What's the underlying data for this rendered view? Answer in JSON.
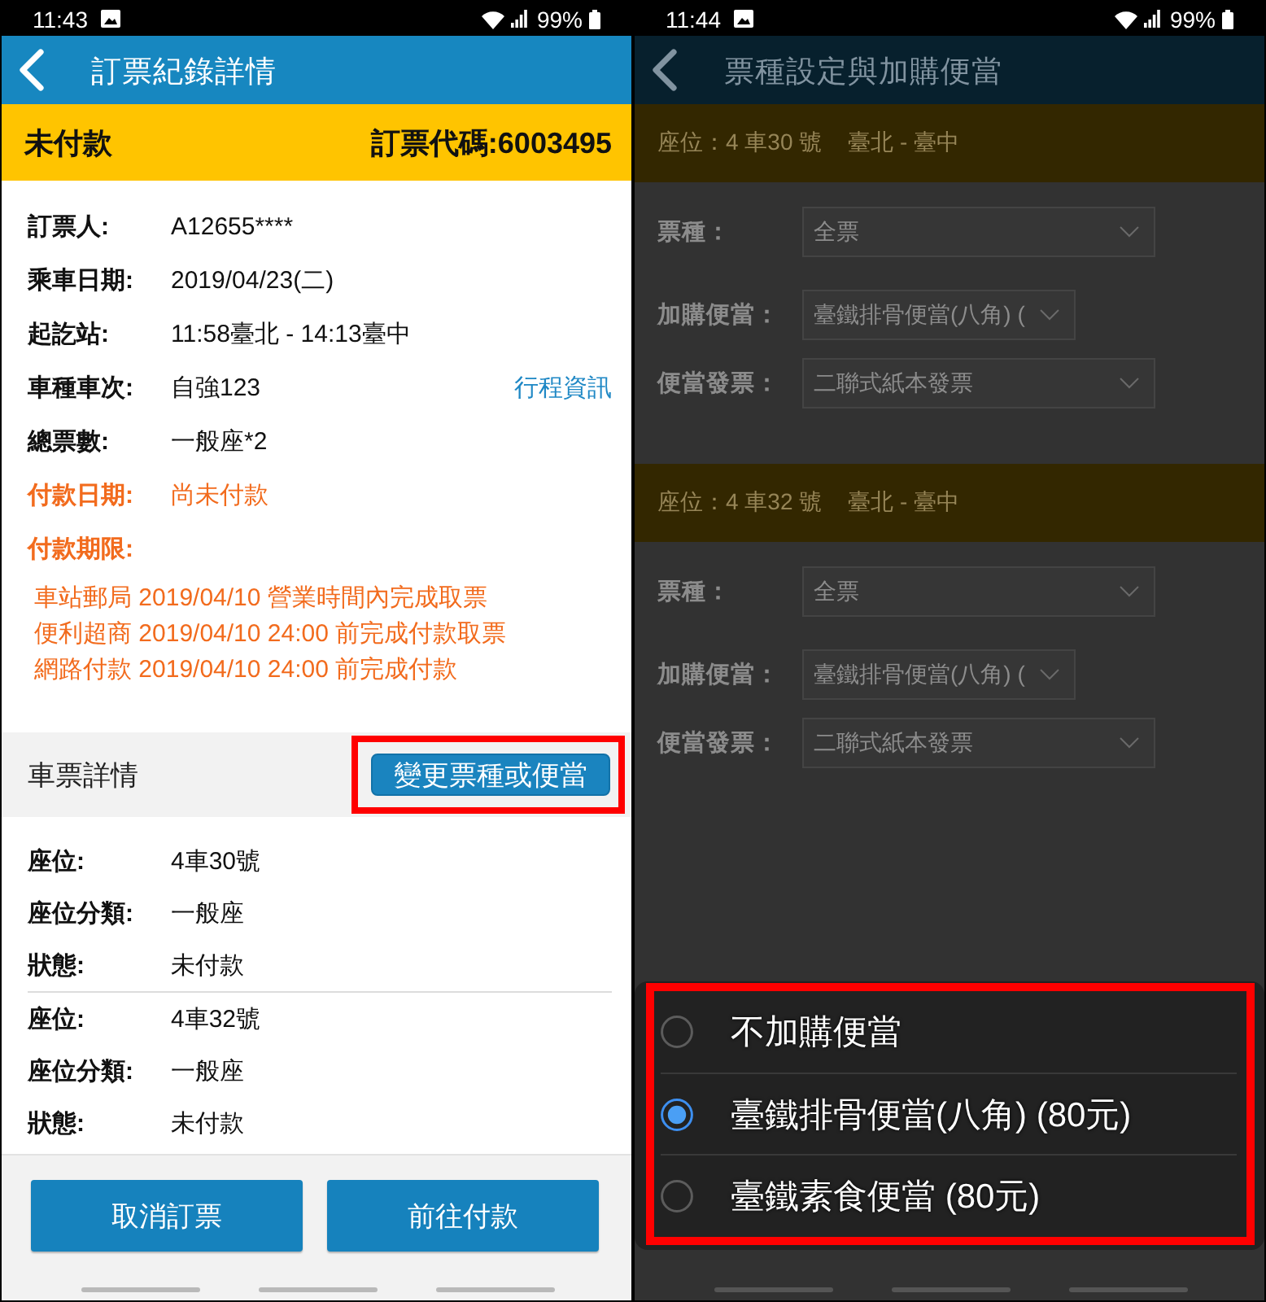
{
  "booking_detail_screen": {
    "status_bar": {
      "time": "11:43",
      "battery": "99%"
    },
    "app_bar": {
      "title": "訂票紀錄詳情"
    },
    "status_banner": {
      "status": "未付款",
      "booking_code": "訂票代碼:6003495"
    },
    "info_rows": [
      {
        "label": "訂票人:",
        "value": "A12655****",
        "warning": false
      },
      {
        "label": "乘車日期:",
        "value": "2019/04/23(二)",
        "warning": false
      },
      {
        "label": "起訖站:",
        "value": "11:58臺北 - 14:13臺中",
        "warning": false
      },
      {
        "label": "車種車次:",
        "value": "自強123",
        "warning": false,
        "link": "行程資訊"
      },
      {
        "label": "總票數:",
        "value": "一般座*2",
        "warning": false
      },
      {
        "label": "付款日期:",
        "value": "尚未付款",
        "warning": true
      }
    ],
    "payment_deadline": {
      "label": "付款期限:",
      "notes": [
        "車站郵局 2019/04/10 營業時間內完成取票",
        "便利超商 2019/04/10 24:00 前完成付款取票",
        "網路付款 2019/04/10 24:00 前完成付款"
      ]
    },
    "ticket_details": {
      "title": "車票詳情",
      "action": {
        "label": "變更票種或便當",
        "highlighted": true
      },
      "seats": [
        {
          "rows": [
            {
              "label": "座位:",
              "value": "4車30號"
            },
            {
              "label": "座位分類:",
              "value": "一般座"
            },
            {
              "label": "狀態:",
              "value": "未付款"
            }
          ]
        },
        {
          "rows": [
            {
              "label": "座位:",
              "value": "4車32號"
            },
            {
              "label": "座位分類:",
              "value": "一般座"
            },
            {
              "label": "狀態:",
              "value": "未付款"
            }
          ]
        }
      ]
    },
    "buttons": [
      "取消訂票",
      "前往付款"
    ]
  },
  "meal_settings_screen": {
    "status_bar": {
      "time": "11:44",
      "battery": "99%"
    },
    "app_bar": {
      "title": "票種設定與加購便當"
    },
    "dimmed": true,
    "seats": [
      {
        "seat": "座位：4 車30 號",
        "route": "臺北 - 臺中",
        "fields": [
          {
            "label": "票種：",
            "value": "全票"
          },
          {
            "label": "加購便當：",
            "value": "臺鐵排骨便當(八角) ("
          },
          {
            "label": "便當發票：",
            "value": "二聯式紙本發票"
          }
        ]
      },
      {
        "seat": "座位：4 車32 號",
        "route": "臺北 - 臺中",
        "fields": [
          {
            "label": "票種：",
            "value": "全票"
          },
          {
            "label": "加購便當：",
            "value": "臺鐵排骨便當(八角) ("
          },
          {
            "label": "便當發票：",
            "value": "二聯式紙本發票"
          }
        ]
      }
    ],
    "meal_sheet": {
      "highlighted": true,
      "options": [
        {
          "label": "不加購便當",
          "selected": false
        },
        {
          "label": "臺鐵排骨便當(八角) (80元)",
          "selected": true
        },
        {
          "label": "臺鐵素食便當 (80元)",
          "selected": false
        }
      ]
    }
  }
}
